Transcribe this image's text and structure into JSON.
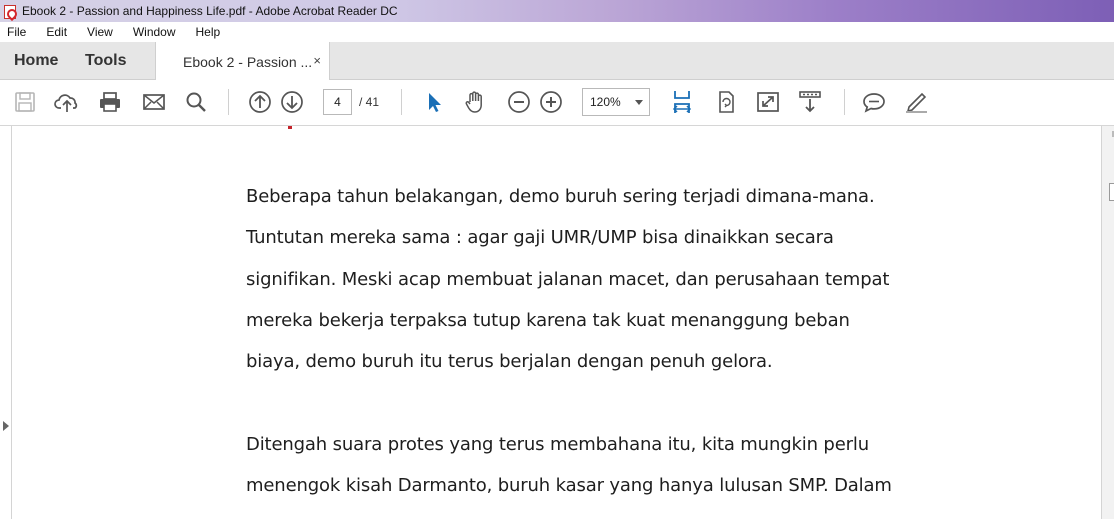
{
  "window": {
    "title": "Ebook 2 - Passion and Happiness Life.pdf - Adobe Acrobat Reader DC"
  },
  "menu": [
    "File",
    "Edit",
    "View",
    "Window",
    "Help"
  ],
  "tabs": {
    "home": "Home",
    "tools": "Tools",
    "document": "Ebook 2 - Passion ...",
    "close": "×"
  },
  "toolbar": {
    "page_current": "4",
    "page_total": "/ 41",
    "zoom": "120%",
    "icons": [
      "save-icon",
      "upload-cloud-icon",
      "print-icon",
      "email-icon",
      "search-icon",
      "page-up-icon",
      "page-down-icon",
      "select-arrow-icon",
      "hand-icon",
      "zoom-out-icon",
      "zoom-in-icon",
      "fit-page-icon",
      "rotate-icon",
      "full-screen-icon",
      "scroll-mode-icon",
      "comment-icon",
      "sign-icon"
    ],
    "accent": "#1a6fb6"
  },
  "document": {
    "paragraphs": [
      [
        "Beberapa tahun belakangan, demo buruh sering terjadi  dimana-mana.",
        "Tuntutan mereka sama : agar gaji UMR/UMP bisa dinaikkan secara",
        "signifikan. Meski acap membuat jalanan macet, dan perusahaan tempat",
        "mereka bekerja terpaksa tutup karena tak kuat menanggung beban",
        "biaya, demo buruh itu terus berjalan dengan penuh gelora."
      ],
      [
        "Ditengah suara protes yang terus membahana itu, kita mungkin perlu",
        "menengok kisah Darmanto, buruh kasar yang hanya lulusan SMP. Dalam"
      ]
    ]
  }
}
